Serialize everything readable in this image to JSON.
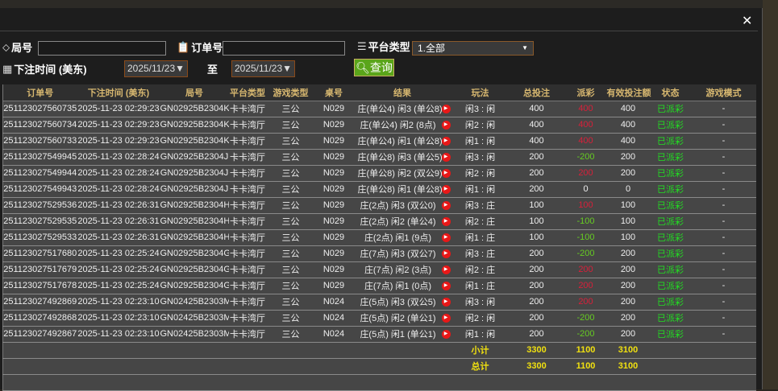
{
  "modal": {
    "close_icon": "close-icon"
  },
  "filters": {
    "round_label": "局号",
    "round_value": "",
    "order_label": "订单号",
    "order_value": "",
    "platform_label": "平台类型",
    "platform_value": "1.全部",
    "time_label": "下注时间 (美东)",
    "date_from": "2025/11/23▼",
    "to_label": "至",
    "date_to": "2025/11/23▼",
    "query_label": "查询"
  },
  "table": {
    "headers": [
      "订单号",
      "下注时间 (美东)",
      "局号",
      "平台类型",
      "游戏类型",
      "桌号",
      "结果",
      "玩法",
      "总投注",
      "派彩",
      "有效投注额",
      "状态",
      "游戏模式"
    ],
    "rows": [
      [
        "251123027560735",
        "2025-11-23 02:29:23",
        "GN02925B2304K",
        "卡卡湾厅",
        "三公",
        "N029",
        "庄(单公4) 闲3 (单公8)",
        "闲3 : 闲",
        "400",
        "400",
        "400",
        "已派彩",
        "-"
      ],
      [
        "251123027560734",
        "2025-11-23 02:29:23",
        "GN02925B2304K",
        "卡卡湾厅",
        "三公",
        "N029",
        "庄(单公4) 闲2 (8点)",
        "闲2 : 闲",
        "400",
        "400",
        "400",
        "已派彩",
        "-"
      ],
      [
        "251123027560733",
        "2025-11-23 02:29:23",
        "GN02925B2304K",
        "卡卡湾厅",
        "三公",
        "N029",
        "庄(单公4) 闲1 (单公8)",
        "闲1 : 闲",
        "400",
        "400",
        "400",
        "已派彩",
        "-"
      ],
      [
        "251123027549945",
        "2025-11-23 02:28:24",
        "GN02925B2304J",
        "卡卡湾厅",
        "三公",
        "N029",
        "庄(单公8) 闲3 (单公5)",
        "闲3 : 闲",
        "200",
        "-200",
        "200",
        "已派彩",
        "-"
      ],
      [
        "251123027549944",
        "2025-11-23 02:28:24",
        "GN02925B2304J",
        "卡卡湾厅",
        "三公",
        "N029",
        "庄(单公8) 闲2 (双公9)",
        "闲2 : 闲",
        "200",
        "200",
        "200",
        "已派彩",
        "-"
      ],
      [
        "251123027549943",
        "2025-11-23 02:28:24",
        "GN02925B2304J",
        "卡卡湾厅",
        "三公",
        "N029",
        "庄(单公8) 闲1 (单公8)",
        "闲1 : 闲",
        "200",
        "0",
        "0",
        "已派彩",
        "-"
      ],
      [
        "251123027529536",
        "2025-11-23 02:26:31",
        "GN02925B2304H",
        "卡卡湾厅",
        "三公",
        "N029",
        "庄(2点) 闲3 (双公0)",
        "闲3 : 庄",
        "100",
        "100",
        "100",
        "已派彩",
        "-"
      ],
      [
        "251123027529535",
        "2025-11-23 02:26:31",
        "GN02925B2304H",
        "卡卡湾厅",
        "三公",
        "N029",
        "庄(2点) 闲2 (单公4)",
        "闲2 : 庄",
        "100",
        "-100",
        "100",
        "已派彩",
        "-"
      ],
      [
        "251123027529533",
        "2025-11-23 02:26:31",
        "GN02925B2304H",
        "卡卡湾厅",
        "三公",
        "N029",
        "庄(2点) 闲1 (9点)",
        "闲1 : 庄",
        "100",
        "-100",
        "100",
        "已派彩",
        "-"
      ],
      [
        "251123027517680",
        "2025-11-23 02:25:24",
        "GN02925B2304G",
        "卡卡湾厅",
        "三公",
        "N029",
        "庄(7点) 闲3 (双公7)",
        "闲3 : 庄",
        "200",
        "-200",
        "200",
        "已派彩",
        "-"
      ],
      [
        "251123027517679",
        "2025-11-23 02:25:24",
        "GN02925B2304G",
        "卡卡湾厅",
        "三公",
        "N029",
        "庄(7点) 闲2 (3点)",
        "闲2 : 庄",
        "200",
        "200",
        "200",
        "已派彩",
        "-"
      ],
      [
        "251123027517678",
        "2025-11-23 02:25:24",
        "GN02925B2304G",
        "卡卡湾厅",
        "三公",
        "N029",
        "庄(7点) 闲1 (0点)",
        "闲1 : 庄",
        "200",
        "200",
        "200",
        "已派彩",
        "-"
      ],
      [
        "251123027492869",
        "2025-11-23 02:23:10",
        "GN02425B2303M",
        "卡卡湾厅",
        "三公",
        "N024",
        "庄(5点) 闲3 (双公5)",
        "闲3 : 闲",
        "200",
        "200",
        "200",
        "已派彩",
        "-"
      ],
      [
        "251123027492868",
        "2025-11-23 02:23:10",
        "GN02425B2303M",
        "卡卡湾厅",
        "三公",
        "N024",
        "庄(5点) 闲2 (单公1)",
        "闲2 : 闲",
        "200",
        "-200",
        "200",
        "已派彩",
        "-"
      ],
      [
        "251123027492867",
        "2025-11-23 02:23:10",
        "GN02425B2303M",
        "卡卡湾厅",
        "三公",
        "N024",
        "庄(5点) 闲1 (单公1)",
        "闲1 : 闲",
        "200",
        "-200",
        "200",
        "已派彩",
        "-"
      ]
    ],
    "subtotal": {
      "label": "小计",
      "total_bet": "3300",
      "payout": "1100",
      "valid_bet": "3100"
    },
    "total": {
      "label": "总计",
      "total_bet": "3300",
      "payout": "1100",
      "valid_bet": "3100"
    }
  },
  "colors": {
    "payout_positive": "#d8203a",
    "payout_negative": "#66cc22",
    "status": "#22dd22",
    "summary": "#f0e010",
    "header": "#d8b870",
    "query_button": "#5aa51a"
  }
}
